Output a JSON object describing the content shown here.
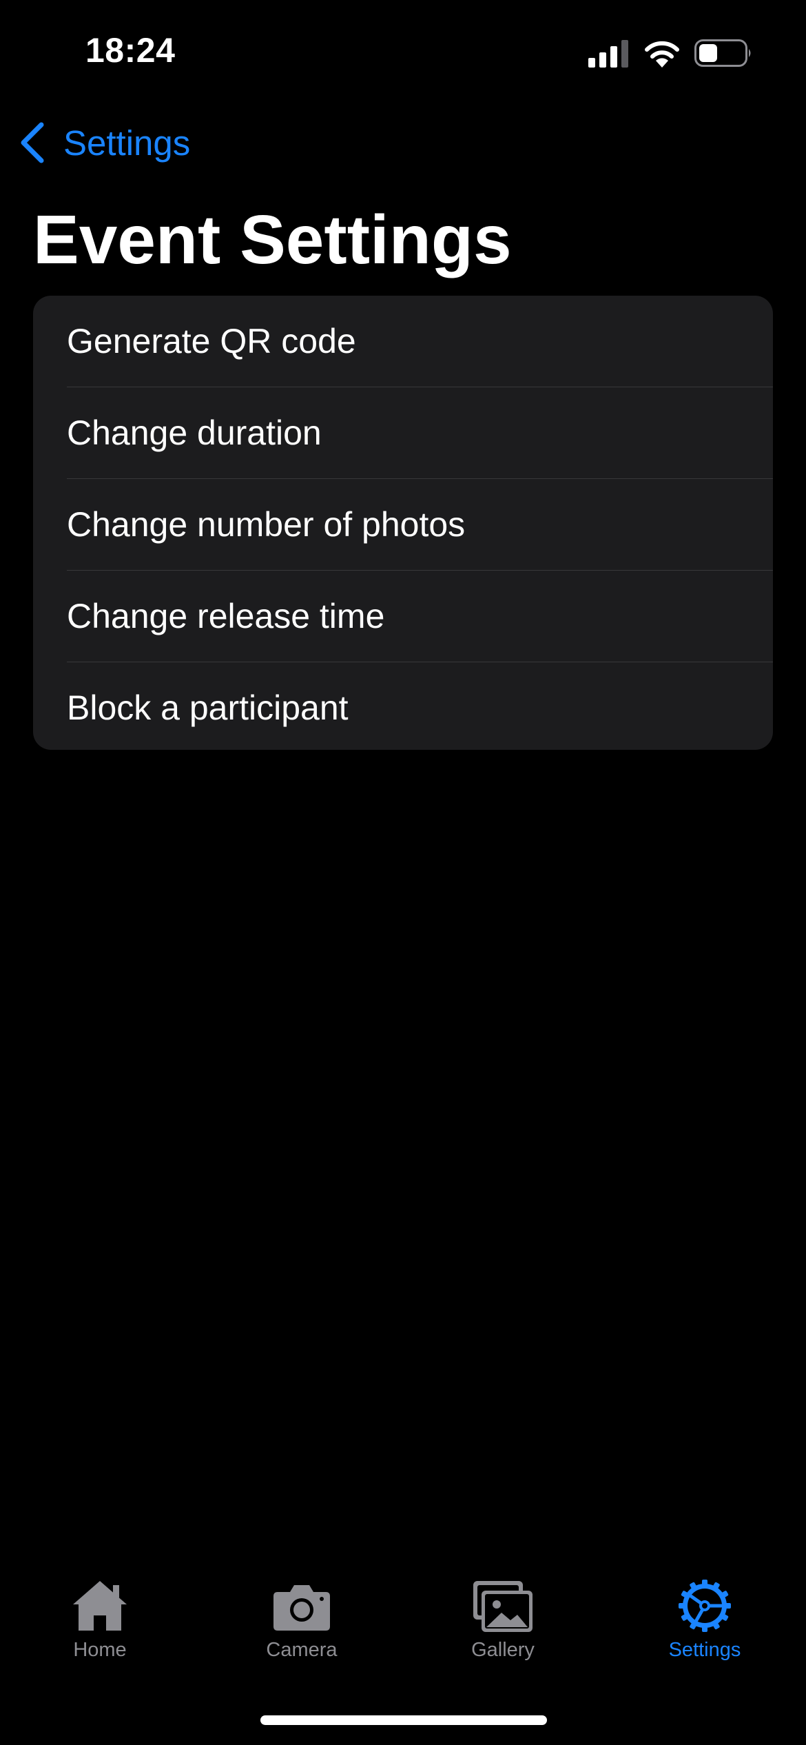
{
  "status_bar": {
    "time": "18:24",
    "signal_icon": "cellular-signal-icon",
    "wifi_icon": "wifi-icon",
    "battery_icon": "battery-icon",
    "battery_level": 0.4
  },
  "nav": {
    "back_label": "Settings",
    "back_icon": "chevron-left-icon"
  },
  "page": {
    "title": "Event Settings"
  },
  "settings_list": {
    "items": [
      {
        "label": "Generate QR code"
      },
      {
        "label": "Change duration"
      },
      {
        "label": "Change number of photos"
      },
      {
        "label": "Change release time"
      },
      {
        "label": "Block a participant"
      }
    ]
  },
  "tab_bar": {
    "tabs": [
      {
        "label": "Home",
        "icon": "house-icon",
        "active": false
      },
      {
        "label": "Camera",
        "icon": "camera-icon",
        "active": false
      },
      {
        "label": "Gallery",
        "icon": "photos-icon",
        "active": false
      },
      {
        "label": "Settings",
        "icon": "gear-icon",
        "active": true
      }
    ]
  },
  "colors": {
    "background": "#000000",
    "card": "#1c1c1e",
    "divider": "#38383a",
    "accent": "#1a84ff",
    "inactive": "#8e8e93",
    "text": "#ffffff"
  }
}
